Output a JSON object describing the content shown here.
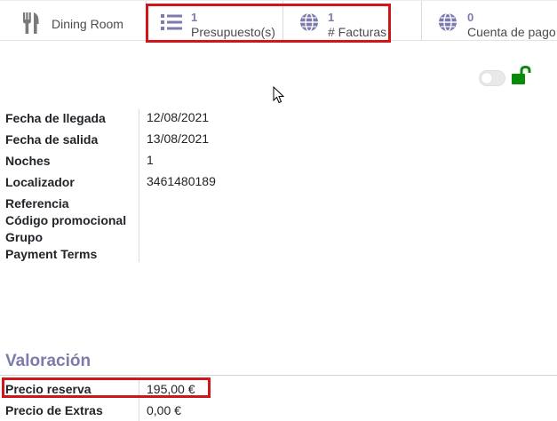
{
  "smart_buttons": {
    "dining_room": {
      "label": "Dining Room",
      "icon": "cutlery-icon"
    },
    "presupuestos": {
      "value": "1",
      "label": "Presupuesto(s)",
      "icon": "list-icon"
    },
    "facturas": {
      "value": "1",
      "label": "# Facturas",
      "icon": "globe-icon"
    },
    "cuenta_pago": {
      "value": "0",
      "label": "Cuenta de pago",
      "icon": "globe-icon"
    }
  },
  "fields": [
    {
      "label": "Fecha de llegada",
      "value": "12/08/2021"
    },
    {
      "label": "Fecha de salida",
      "value": "13/08/2021"
    },
    {
      "label": "Noches",
      "value": "1"
    },
    {
      "label": "Localizador",
      "value": "3461480189"
    },
    {
      "label": "Referencia",
      "value": ""
    },
    {
      "label": "Código promocional",
      "value": ""
    },
    {
      "label": "Grupo",
      "value": ""
    },
    {
      "label": "Payment Terms",
      "value": ""
    }
  ],
  "valoracion": {
    "title": "Valoración",
    "rows": [
      {
        "label": "Precio reserva",
        "value": "195,00 €"
      },
      {
        "label": "Precio de Extras",
        "value": "0,00 €"
      }
    ]
  },
  "colors": {
    "accent": "#7c7bad",
    "highlight": "#d0161b",
    "lock_green": "#0a8a0a"
  }
}
